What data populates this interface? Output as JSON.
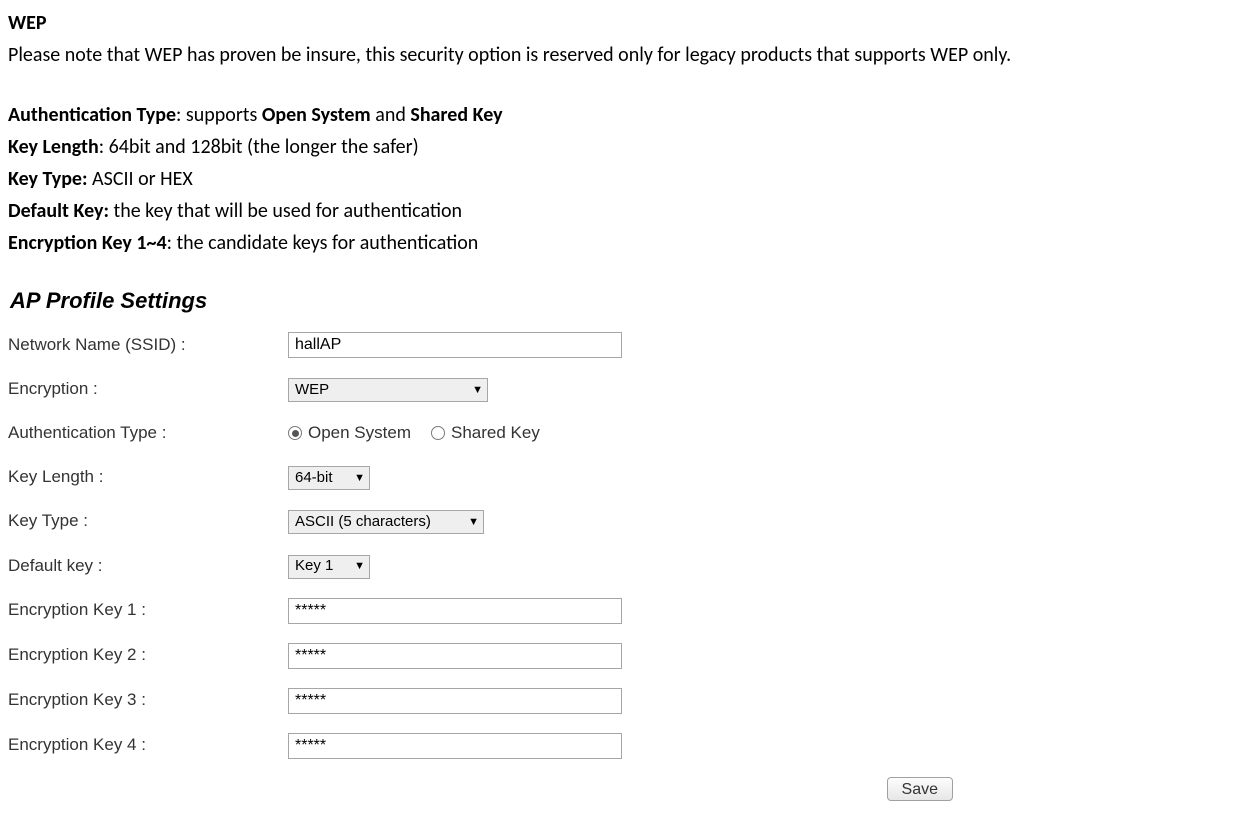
{
  "doc": {
    "heading": "WEP",
    "note": "Please note that WEP has proven be insure, this security option is reserved only for legacy products that supports WEP only.",
    "paras": {
      "authtype": {
        "label": "Authentication Type",
        "sep": ": supports ",
        "v1": "Open System",
        "mid": " and ",
        "v2": "Shared Key"
      },
      "keylen": {
        "label": "Key Length",
        "rest": ": 64bit and 128bit (the longer the safer)"
      },
      "keytype": {
        "label": "Key Type:",
        "rest": " ASCII or HEX"
      },
      "defkey": {
        "label": "Default Key:",
        "rest": " the key that will be used for authentication"
      },
      "enckeys": {
        "label": "Encryption Key 1~4",
        "rest": ": the candidate keys for authentication"
      }
    }
  },
  "panel": {
    "title": "AP Profile Settings",
    "fields": {
      "ssid": {
        "label": "Network Name (SSID) :",
        "value": "hallAP"
      },
      "encryption": {
        "label": "Encryption :",
        "value": "WEP"
      },
      "authtype": {
        "label": "Authentication Type :",
        "opt1": "Open System",
        "opt2": "Shared Key"
      },
      "keylength": {
        "label": "Key Length :",
        "value": "64-bit"
      },
      "keytype": {
        "label": "Key Type :",
        "value": "ASCII (5 characters)"
      },
      "defaultkey": {
        "label": "Default key :",
        "value": "Key 1"
      },
      "key1": {
        "label": "Encryption Key 1 :",
        "value": "*****"
      },
      "key2": {
        "label": "Encryption Key 2 :",
        "value": "*****"
      },
      "key3": {
        "label": "Encryption Key 3 :",
        "value": "*****"
      },
      "key4": {
        "label": "Encryption Key 4 :",
        "value": "*****"
      }
    },
    "save": "Save"
  }
}
